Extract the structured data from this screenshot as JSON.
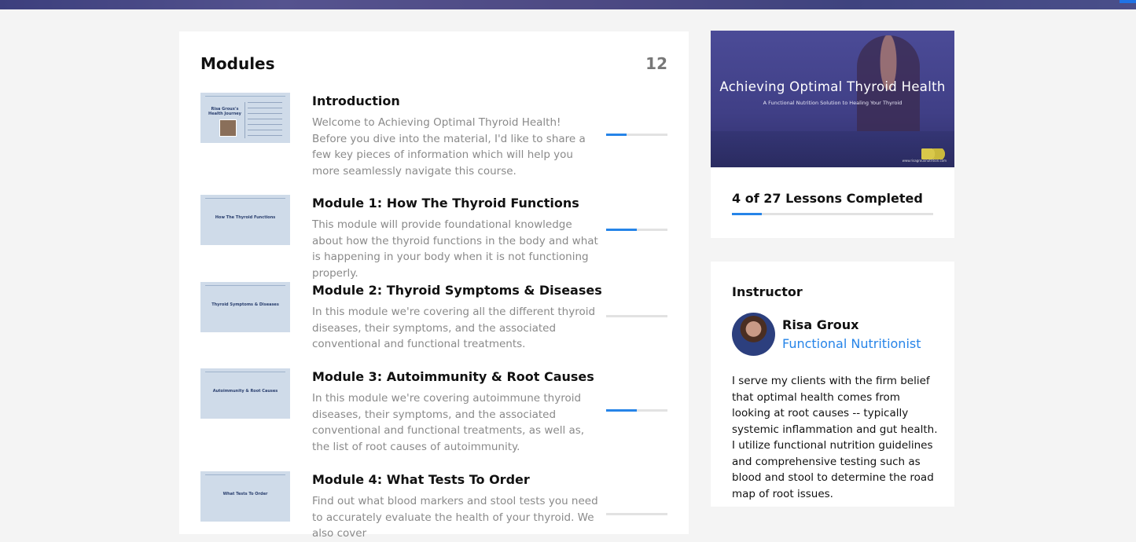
{
  "modules": {
    "heading": "Modules",
    "count": "12",
    "items": [
      {
        "title": "Introduction",
        "description": "Welcome to Achieving Optimal Thyroid Health! Before you dive into the material, I'd like to share a few key pieces of information which will help you more seamlessly navigate this course.",
        "thumbnail_text": "Risa Groux's Health Journey",
        "progress": 0.33
      },
      {
        "title": "Module 1: How The Thyroid Functions",
        "description": "This module will provide foundational knowledge about how the thyroid functions in the body and what is happening in your body when it is not functioning properly.",
        "thumbnail_text": "How The Thyroid Functions",
        "progress": 0.5
      },
      {
        "title": "Module 2: Thyroid Symptoms & Diseases",
        "description": "In this module we're covering all the different thyroid diseases, their symptoms, and the associated conventional and functional treatments.",
        "thumbnail_text": "Thyroid Symptoms & Diseases",
        "progress": 0
      },
      {
        "title": "Module 3: Autoimmunity & Root Causes",
        "description": "In this module we're covering autoimmune thyroid diseases, their symptoms, and the associated conventional and functional treatments, as well as, the list of root causes of autoimmunity.",
        "thumbnail_text": "Autoimmunity & Root Causes",
        "progress": 0.5
      },
      {
        "title": "Module 4: What Tests To Order",
        "description": "Find out what blood markers and stool tests you need to accurately evaluate the health of your thyroid. We also cover",
        "thumbnail_text": "What Tests To Order",
        "progress": 0
      }
    ]
  },
  "course": {
    "hero_title": "Achieving Optimal Thyroid Health",
    "hero_subtitle": "A Functional Nutrition Solution to Healing Your Thyroid",
    "hero_footer_right": "www.risagrouxnutrition.com",
    "lessons_completed_text": "4 of 27 Lessons Completed",
    "lessons_progress": 0.15
  },
  "instructor": {
    "heading": "Instructor",
    "name": "Risa Groux",
    "title": "Functional Nutritionist",
    "bio": "I serve my clients with the firm belief that optimal health comes from looking at root causes -- typically systemic inflammation and gut health. I utilize functional nutrition guidelines and comprehensive testing such as blood and stool to determine the road map of root issues."
  },
  "colors": {
    "accent": "#2684e8",
    "progress_track": "#e2e2e2",
    "hero_background": "#403f86",
    "muted_text": "#8a8a8a"
  }
}
